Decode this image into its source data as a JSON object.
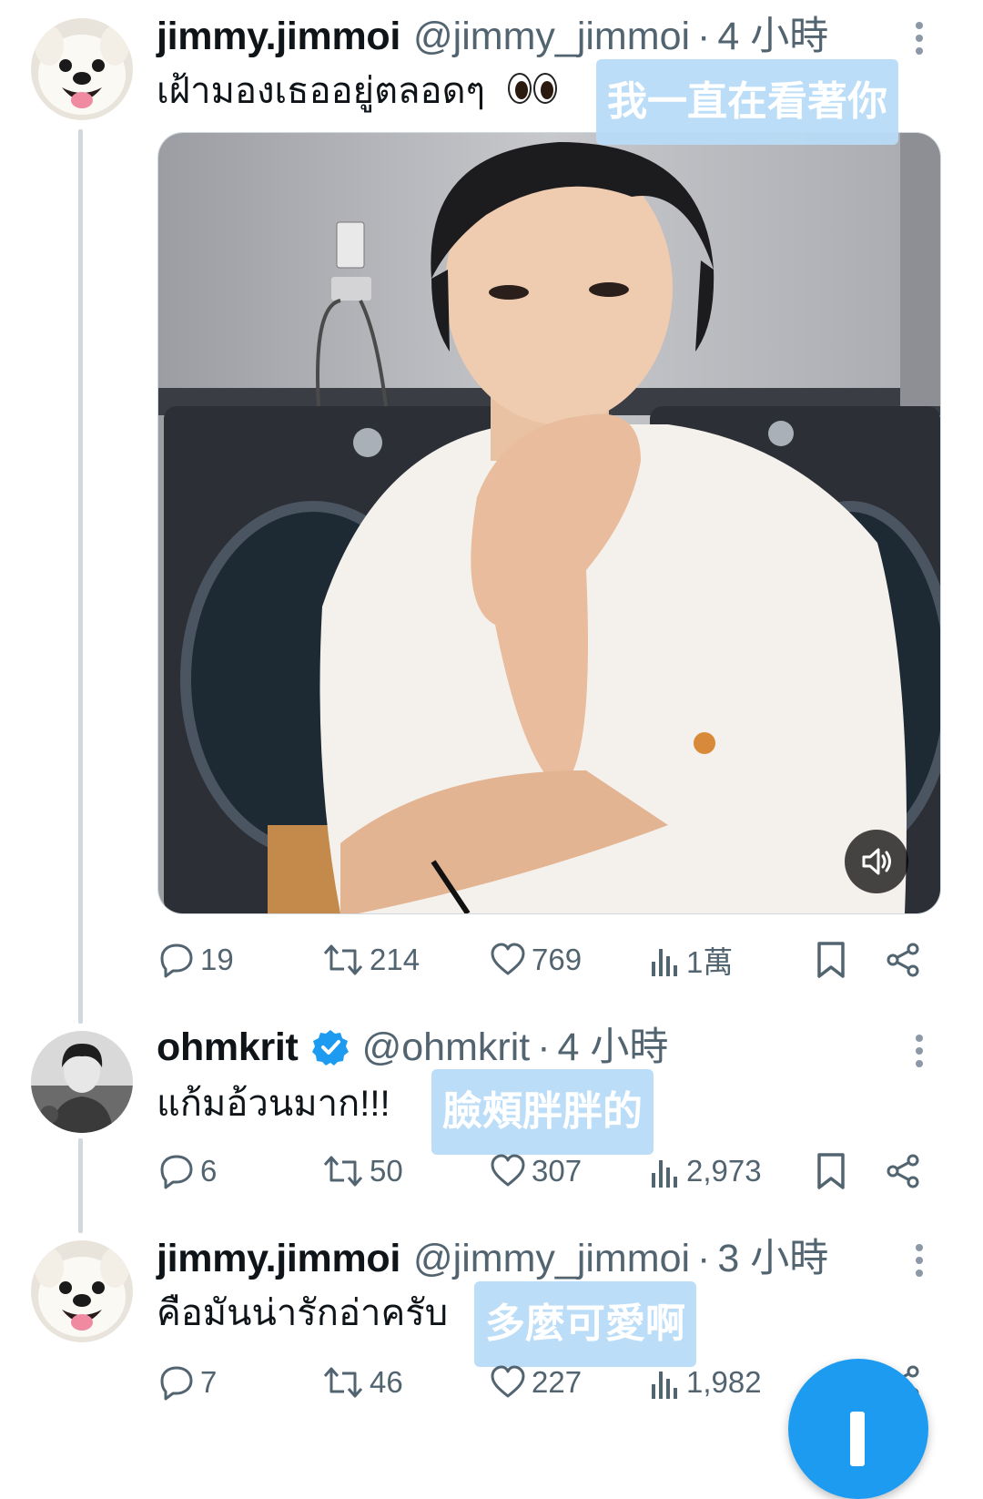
{
  "tweets": [
    {
      "display_name": "jimmy.jimmoi",
      "handle": "@jimmy_jimmoi",
      "time": "4 小時",
      "text": "เฝ้ามองเธออยู่ตลอดๆ",
      "caption": "我一直在看著你",
      "replies": "19",
      "retweets": "214",
      "likes": "769",
      "views": "1萬"
    },
    {
      "display_name": "ohmkrit",
      "handle": "@ohmkrit",
      "time": "4 小時",
      "text": "แก้มอ้วนมาก!!!",
      "caption": "臉頰胖胖的",
      "replies": "6",
      "retweets": "50",
      "likes": "307",
      "views": "2,973"
    },
    {
      "display_name": "jimmy.jimmoi",
      "handle": "@jimmy_jimmoi",
      "time": "3 小時",
      "text": "คือมันน่ารักอ่าครับ",
      "caption": "多麼可愛啊",
      "replies": "7",
      "retweets": "46",
      "likes": "227",
      "views": "1,982"
    }
  ],
  "separator": "·",
  "icons": {
    "reply": "reply-icon",
    "retweet": "retweet-icon",
    "like": "heart-icon",
    "views": "views-chart-icon",
    "bookmark": "bookmark-icon",
    "share": "share-icon",
    "more": "more-vertical-icon",
    "verified": "verified-badge-icon",
    "mute": "speaker-icon",
    "compose": "plus-icon"
  },
  "colors": {
    "accent": "#1d9bf0",
    "secondary_text": "#536471",
    "caption_bg": "#b9dcf7",
    "thread_line": "#cfd9de"
  }
}
